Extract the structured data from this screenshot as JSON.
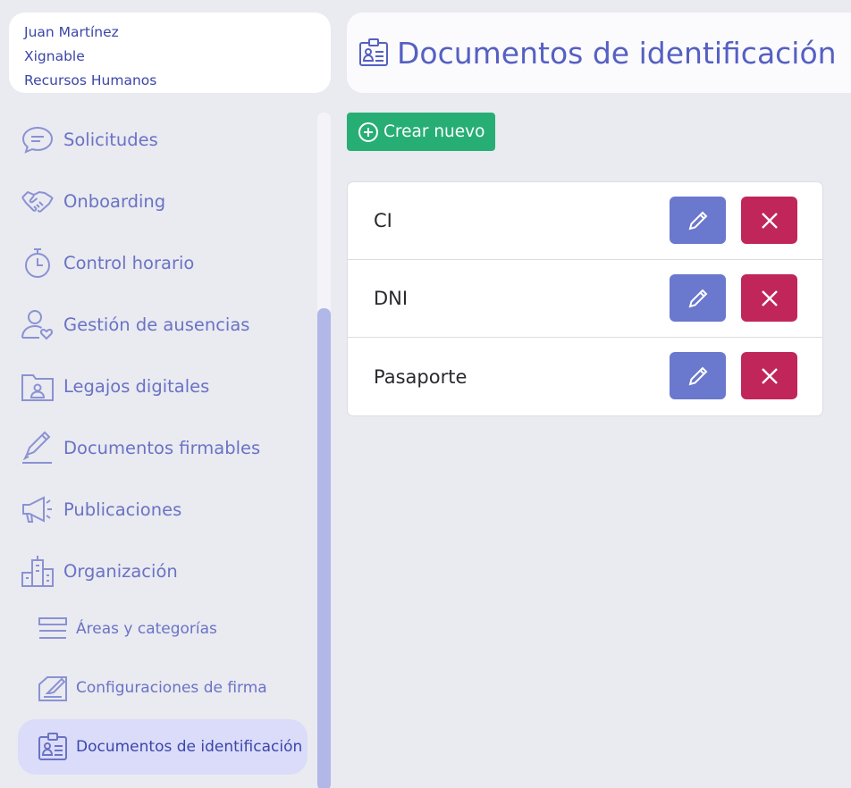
{
  "user": {
    "name": "Juan Martínez",
    "company": "Xignable",
    "department": "Recursos Humanos"
  },
  "sidebar": {
    "items": [
      {
        "label": "Solicitudes",
        "icon": "chat-bubble-icon"
      },
      {
        "label": "Onboarding",
        "icon": "handshake-icon"
      },
      {
        "label": "Control horario",
        "icon": "stopwatch-icon"
      },
      {
        "label": "Gestión de ausencias",
        "icon": "user-heart-icon"
      },
      {
        "label": "Legajos digitales",
        "icon": "folder-user-icon"
      },
      {
        "label": "Documentos firmables",
        "icon": "pen-sign-icon"
      },
      {
        "label": "Publicaciones",
        "icon": "megaphone-icon"
      },
      {
        "label": "Organización",
        "icon": "buildings-icon"
      }
    ],
    "subitems": [
      {
        "label": "Áreas y categorías",
        "icon": "list-lines-icon"
      },
      {
        "label": "Configuraciones de firma",
        "icon": "signature-pad-icon"
      },
      {
        "label": "Documentos de identificación",
        "icon": "id-badge-icon",
        "active": true
      }
    ]
  },
  "header": {
    "title": "Documentos de identificación",
    "icon": "id-badge-icon"
  },
  "toolbar": {
    "create_label": "Crear nuevo"
  },
  "documents": [
    {
      "name": "CI"
    },
    {
      "name": "DNI"
    },
    {
      "name": "Pasaporte"
    }
  ],
  "colors": {
    "accent": "#5560c2",
    "create": "#27ae74",
    "edit": "#6a78cd",
    "delete": "#c0265a",
    "active_bg": "#dadcfa"
  }
}
